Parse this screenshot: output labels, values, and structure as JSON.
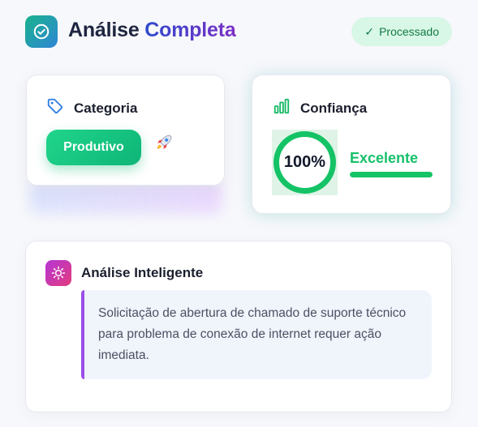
{
  "header": {
    "title_part1": "Análise",
    "title_part2": "Completa",
    "logo_icon": "check-circle-icon",
    "status_badge": "Processado",
    "status_icon": "check-icon"
  },
  "category_card": {
    "title": "Categoria",
    "icon": "tag-icon",
    "value": "Produtivo",
    "decoration_icon": "rocket-icon"
  },
  "confidence_card": {
    "title": "Confiança",
    "icon": "bar-chart-icon",
    "value_label": "100%",
    "value_percent": 100,
    "rating": "Excelente",
    "rating_bar_percent": 100
  },
  "analysis_card": {
    "title": "Análise Inteligente",
    "icon": "sun-icon",
    "text": "Solicitação de abertura de chamado de suporte técnico para problema de conexão de internet requer ação imediata."
  },
  "colors": {
    "accent_green": "#14c366",
    "title_gradient_start": "#2f4bcc",
    "title_gradient_end": "#7c2fc6",
    "analysis_border": "#9b4fe6",
    "badge_bg": "#d8f7e6"
  }
}
